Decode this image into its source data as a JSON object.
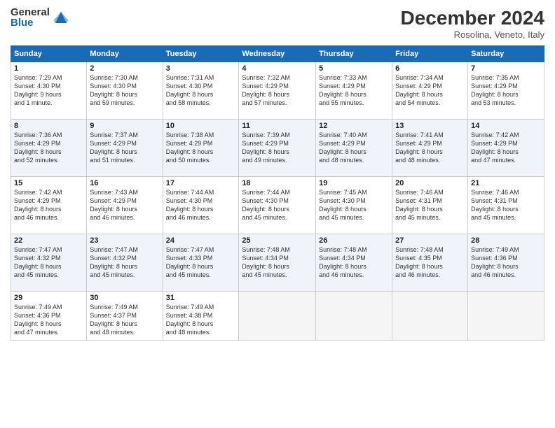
{
  "logo": {
    "general": "General",
    "blue": "Blue"
  },
  "title": "December 2024",
  "subtitle": "Rosolina, Veneto, Italy",
  "headers": [
    "Sunday",
    "Monday",
    "Tuesday",
    "Wednesday",
    "Thursday",
    "Friday",
    "Saturday"
  ],
  "weeks": [
    [
      {
        "day": "1",
        "info": "Sunrise: 7:29 AM\nSunset: 4:30 PM\nDaylight: 9 hours\nand 1 minute."
      },
      {
        "day": "2",
        "info": "Sunrise: 7:30 AM\nSunset: 4:30 PM\nDaylight: 8 hours\nand 59 minutes."
      },
      {
        "day": "3",
        "info": "Sunrise: 7:31 AM\nSunset: 4:30 PM\nDaylight: 8 hours\nand 58 minutes."
      },
      {
        "day": "4",
        "info": "Sunrise: 7:32 AM\nSunset: 4:29 PM\nDaylight: 8 hours\nand 57 minutes."
      },
      {
        "day": "5",
        "info": "Sunrise: 7:33 AM\nSunset: 4:29 PM\nDaylight: 8 hours\nand 55 minutes."
      },
      {
        "day": "6",
        "info": "Sunrise: 7:34 AM\nSunset: 4:29 PM\nDaylight: 8 hours\nand 54 minutes."
      },
      {
        "day": "7",
        "info": "Sunrise: 7:35 AM\nSunset: 4:29 PM\nDaylight: 8 hours\nand 53 minutes."
      }
    ],
    [
      {
        "day": "8",
        "info": "Sunrise: 7:36 AM\nSunset: 4:29 PM\nDaylight: 8 hours\nand 52 minutes."
      },
      {
        "day": "9",
        "info": "Sunrise: 7:37 AM\nSunset: 4:29 PM\nDaylight: 8 hours\nand 51 minutes."
      },
      {
        "day": "10",
        "info": "Sunrise: 7:38 AM\nSunset: 4:29 PM\nDaylight: 8 hours\nand 50 minutes."
      },
      {
        "day": "11",
        "info": "Sunrise: 7:39 AM\nSunset: 4:29 PM\nDaylight: 8 hours\nand 49 minutes."
      },
      {
        "day": "12",
        "info": "Sunrise: 7:40 AM\nSunset: 4:29 PM\nDaylight: 8 hours\nand 48 minutes."
      },
      {
        "day": "13",
        "info": "Sunrise: 7:41 AM\nSunset: 4:29 PM\nDaylight: 8 hours\nand 48 minutes."
      },
      {
        "day": "14",
        "info": "Sunrise: 7:42 AM\nSunset: 4:29 PM\nDaylight: 8 hours\nand 47 minutes."
      }
    ],
    [
      {
        "day": "15",
        "info": "Sunrise: 7:42 AM\nSunset: 4:29 PM\nDaylight: 8 hours\nand 46 minutes."
      },
      {
        "day": "16",
        "info": "Sunrise: 7:43 AM\nSunset: 4:29 PM\nDaylight: 8 hours\nand 46 minutes."
      },
      {
        "day": "17",
        "info": "Sunrise: 7:44 AM\nSunset: 4:30 PM\nDaylight: 8 hours\nand 46 minutes."
      },
      {
        "day": "18",
        "info": "Sunrise: 7:44 AM\nSunset: 4:30 PM\nDaylight: 8 hours\nand 45 minutes."
      },
      {
        "day": "19",
        "info": "Sunrise: 7:45 AM\nSunset: 4:30 PM\nDaylight: 8 hours\nand 45 minutes."
      },
      {
        "day": "20",
        "info": "Sunrise: 7:46 AM\nSunset: 4:31 PM\nDaylight: 8 hours\nand 45 minutes."
      },
      {
        "day": "21",
        "info": "Sunrise: 7:46 AM\nSunset: 4:31 PM\nDaylight: 8 hours\nand 45 minutes."
      }
    ],
    [
      {
        "day": "22",
        "info": "Sunrise: 7:47 AM\nSunset: 4:32 PM\nDaylight: 8 hours\nand 45 minutes."
      },
      {
        "day": "23",
        "info": "Sunrise: 7:47 AM\nSunset: 4:32 PM\nDaylight: 8 hours\nand 45 minutes."
      },
      {
        "day": "24",
        "info": "Sunrise: 7:47 AM\nSunset: 4:33 PM\nDaylight: 8 hours\nand 45 minutes."
      },
      {
        "day": "25",
        "info": "Sunrise: 7:48 AM\nSunset: 4:34 PM\nDaylight: 8 hours\nand 45 minutes."
      },
      {
        "day": "26",
        "info": "Sunrise: 7:48 AM\nSunset: 4:34 PM\nDaylight: 8 hours\nand 46 minutes."
      },
      {
        "day": "27",
        "info": "Sunrise: 7:48 AM\nSunset: 4:35 PM\nDaylight: 8 hours\nand 46 minutes."
      },
      {
        "day": "28",
        "info": "Sunrise: 7:49 AM\nSunset: 4:36 PM\nDaylight: 8 hours\nand 46 minutes."
      }
    ],
    [
      {
        "day": "29",
        "info": "Sunrise: 7:49 AM\nSunset: 4:36 PM\nDaylight: 8 hours\nand 47 minutes."
      },
      {
        "day": "30",
        "info": "Sunrise: 7:49 AM\nSunset: 4:37 PM\nDaylight: 8 hours\nand 48 minutes."
      },
      {
        "day": "31",
        "info": "Sunrise: 7:49 AM\nSunset: 4:38 PM\nDaylight: 8 hours\nand 48 minutes."
      },
      {
        "day": "",
        "info": ""
      },
      {
        "day": "",
        "info": ""
      },
      {
        "day": "",
        "info": ""
      },
      {
        "day": "",
        "info": ""
      }
    ]
  ]
}
